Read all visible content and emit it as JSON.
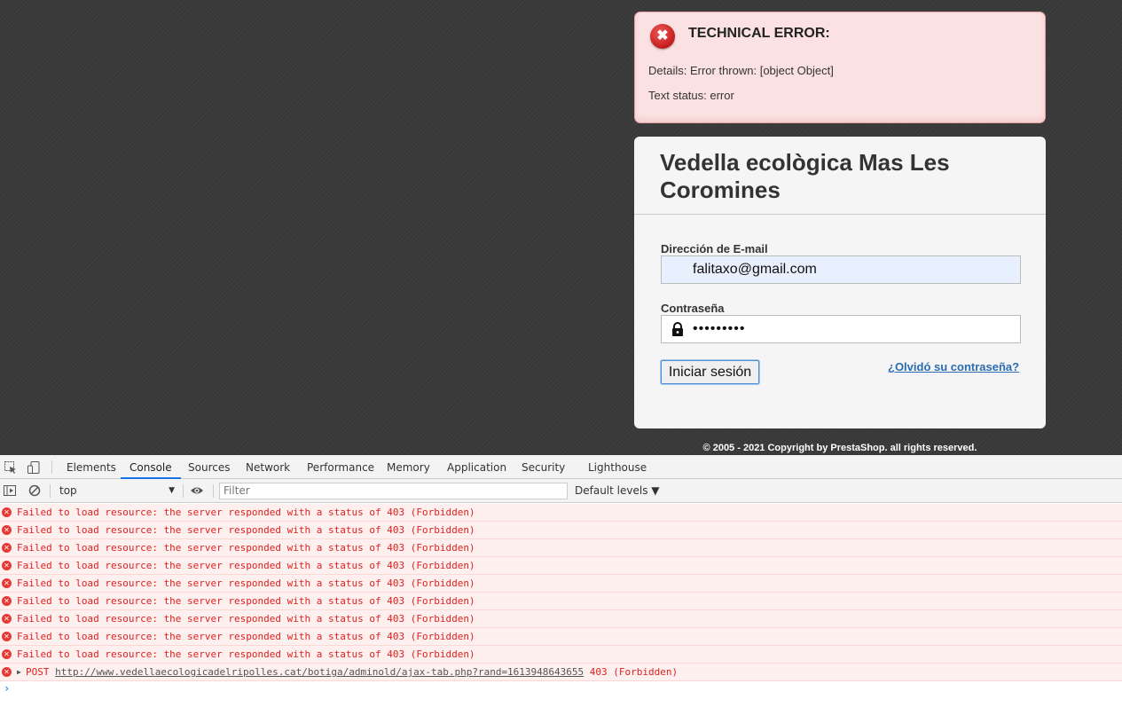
{
  "error_box": {
    "title": "TECHNICAL ERROR:",
    "details": "Details: Error thrown: [object Object]",
    "status": "Text status: error"
  },
  "login": {
    "shop_name": "Vedella ecològica Mas Les Coromines",
    "email_label": "Dirección de E-mail",
    "email_value": "falitaxo@gmail.com",
    "password_label": "Contraseña",
    "password_mask": "•••••••••",
    "submit_label": "Iniciar sesión",
    "forgot_label": "¿Olvidó su contraseña?"
  },
  "footer": {
    "copyright": "© 2005 - 2021 Copyright by PrestaShop. all rights reserved."
  },
  "devtools": {
    "tabs": [
      "Elements",
      "Console",
      "Sources",
      "Network",
      "Performance",
      "Memory",
      "Application",
      "Security",
      "Lighthouse"
    ],
    "active_tab": "Console",
    "context": "top",
    "filter_placeholder": "Filter",
    "levels": "Default levels ▼",
    "messages": [
      "Failed to load resource: the server responded with a status of 403 (Forbidden)",
      "Failed to load resource: the server responded with a status of 403 (Forbidden)",
      "Failed to load resource: the server responded with a status of 403 (Forbidden)",
      "Failed to load resource: the server responded with a status of 403 (Forbidden)",
      "Failed to load resource: the server responded with a status of 403 (Forbidden)",
      "Failed to load resource: the server responded with a status of 403 (Forbidden)",
      "Failed to load resource: the server responded with a status of 403 (Forbidden)",
      "Failed to load resource: the server responded with a status of 403 (Forbidden)",
      "Failed to load resource: the server responded with a status of 403 (Forbidden)"
    ],
    "post": {
      "method": "POST",
      "url": "http://www.vedellaecologicadelripolles.cat/botiga/adminold/ajax-tab.php?rand=1613948643655",
      "status": "403 (Forbidden)"
    },
    "prompt": "›"
  },
  "colors": {
    "error_red": "#e0201f",
    "link_blue": "#2b6cb0",
    "tab_accent": "#1a73e8"
  }
}
